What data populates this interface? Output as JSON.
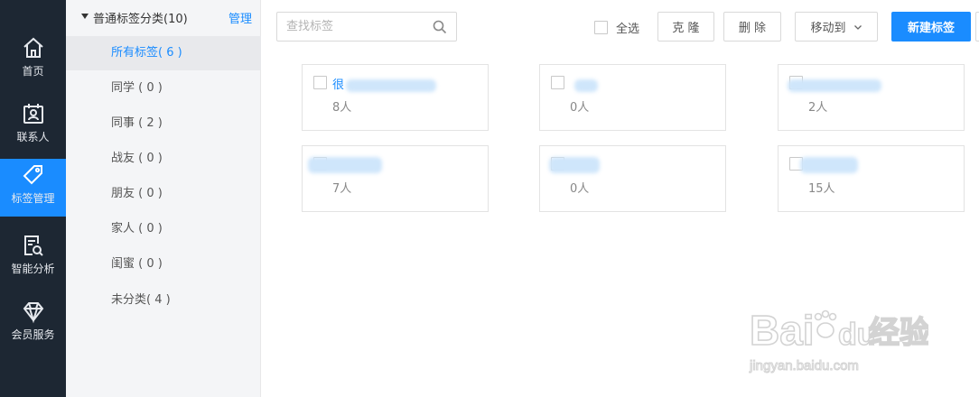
{
  "nav": {
    "items": [
      {
        "label": "首页",
        "icon": "home-icon"
      },
      {
        "label": "联系人",
        "icon": "contacts-icon"
      },
      {
        "label": "标签管理",
        "icon": "tag-icon",
        "active": true
      },
      {
        "label": "智能分析",
        "icon": "analysis-icon"
      },
      {
        "label": "会员服务",
        "icon": "diamond-icon"
      }
    ]
  },
  "categories": {
    "group_title": "普通标签分类(10)",
    "manage_label": "管理",
    "items": [
      {
        "label": "所有标签( 6 )",
        "active": true
      },
      {
        "label": "同学 ( 0 )"
      },
      {
        "label": "同事 ( 2 )"
      },
      {
        "label": "战友 ( 0 )"
      },
      {
        "label": "朋友 ( 0 )"
      },
      {
        "label": "家人 ( 0 )"
      },
      {
        "label": "闺蜜 ( 0 )"
      },
      {
        "label": "未分类( 4 )"
      }
    ]
  },
  "toolbar": {
    "search_placeholder": "查找标签",
    "select_all_label": "全选",
    "clone_label": "克 隆",
    "delete_label": "删 除",
    "move_to_label": "移动到",
    "new_tag_label": "新建标签"
  },
  "tags": [
    {
      "name": "很",
      "count": "8人"
    },
    {
      "name": "",
      "count": "0人"
    },
    {
      "name": "",
      "count": "2人"
    },
    {
      "name": "",
      "count": "7人"
    },
    {
      "name": "",
      "count": "0人"
    },
    {
      "name": "",
      "count": "15人"
    }
  ],
  "watermark": {
    "line1": "Bai",
    "line2": "du",
    "line3": "经验",
    "line4": "jingyan.baidu.com"
  },
  "colors": {
    "accent": "#1a8cff",
    "nav_bg": "#1d2733"
  }
}
